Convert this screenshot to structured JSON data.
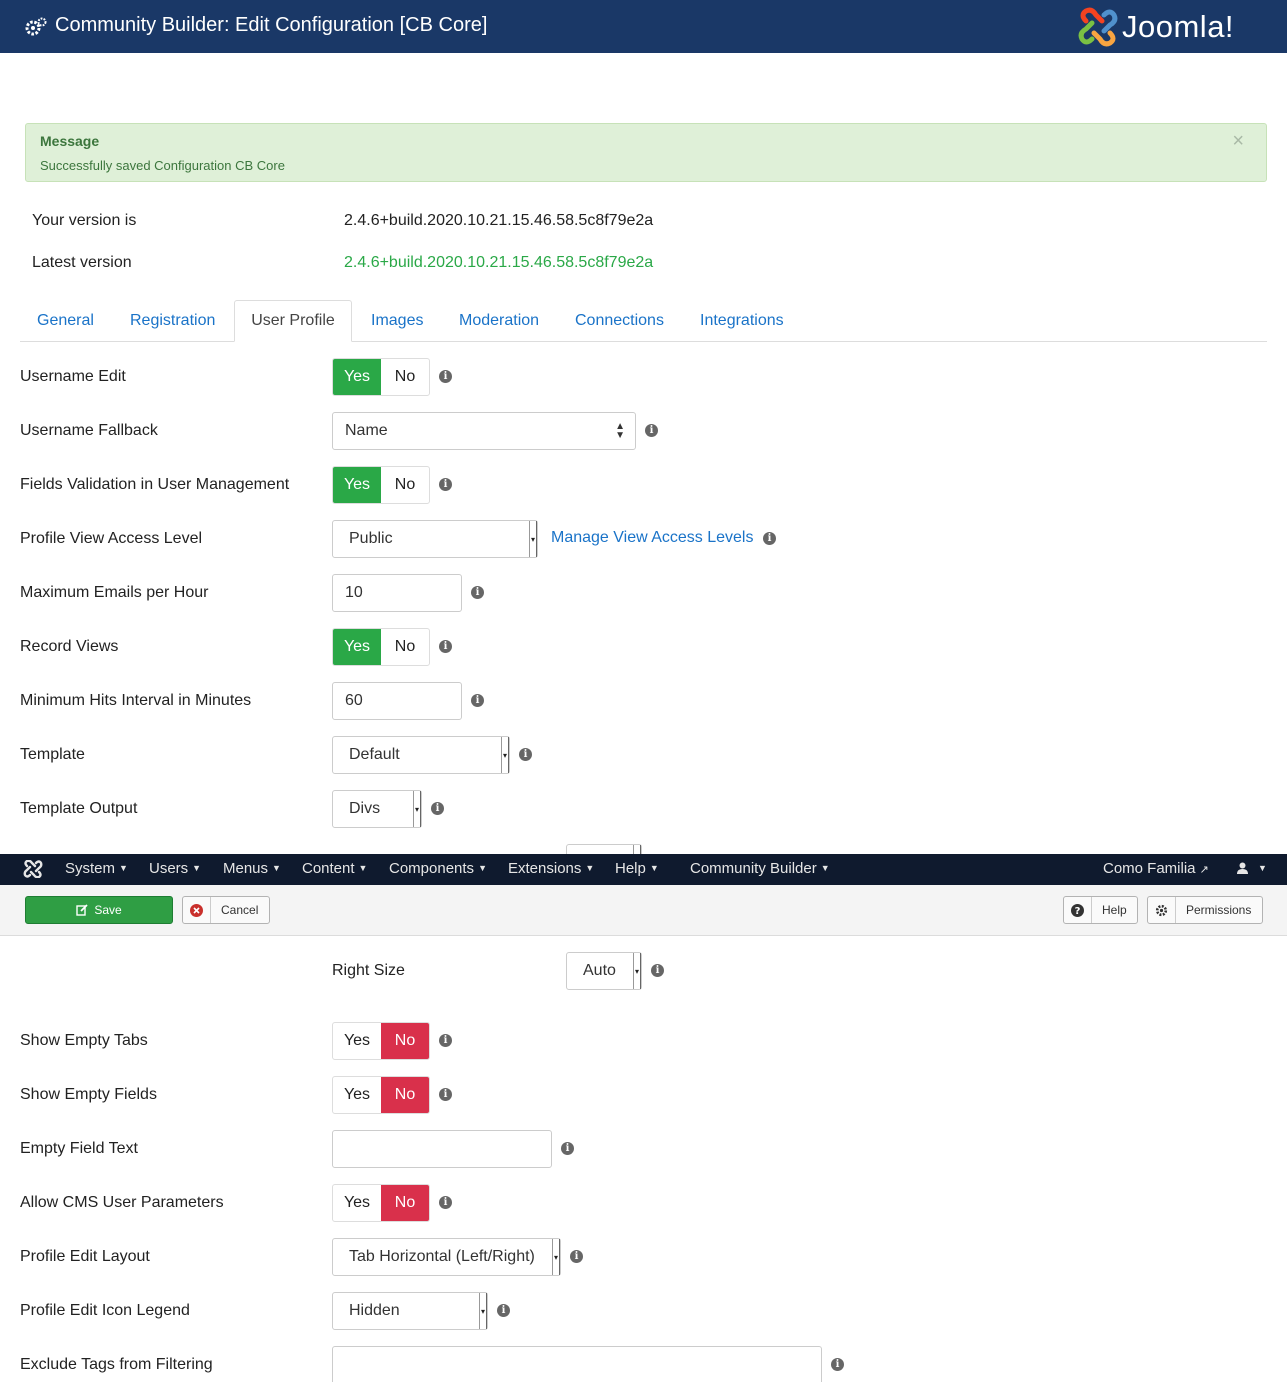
{
  "header": {
    "title": "Community Builder: Edit Configuration [CB Core]",
    "brand": "Joomla!"
  },
  "message": {
    "heading": "Message",
    "text": "Successfully saved Configuration CB Core",
    "close": "×"
  },
  "version": {
    "your_label": "Your version is",
    "your_value": "2.4.6+build.2020.10.21.15.46.58.5c8f79e2a",
    "latest_label": "Latest version",
    "latest_value": "2.4.6+build.2020.10.21.15.46.58.5c8f79e2a"
  },
  "tabs": [
    "General",
    "Registration",
    "User Profile",
    "Images",
    "Moderation",
    "Connections",
    "Integrations"
  ],
  "fields": {
    "username_edit": "Username Edit",
    "username_fallback": "Username Fallback",
    "username_fallback_value": "Name",
    "fields_validation": "Fields Validation in User Management",
    "profile_view_access": "Profile View Access Level",
    "profile_view_access_value": "Public",
    "manage_view_access": "Manage View Access Levels",
    "max_emails": "Maximum Emails per Hour",
    "max_emails_value": "10",
    "record_views": "Record Views",
    "min_hits": "Minimum Hits Interval in Minutes",
    "min_hits_value": "60",
    "template": "Template",
    "template_value": "Default",
    "template_output": "Template Output",
    "template_output_value": "Divs",
    "right_size": "Right Size",
    "right_size_value": "Auto",
    "show_empty_tabs": "Show Empty Tabs",
    "show_empty_fields": "Show Empty Fields",
    "empty_field_text": "Empty Field Text",
    "empty_field_text_value": "",
    "allow_cms_params": "Allow CMS User Parameters",
    "profile_edit_layout": "Profile Edit Layout",
    "profile_edit_layout_value": "Tab Horizontal (Left/Right)",
    "profile_edit_icon": "Profile Edit Icon Legend",
    "profile_edit_icon_value": "Hidden",
    "exclude_tags": "Exclude Tags from Filtering",
    "exclude_tags_value": ""
  },
  "toggle": {
    "yes": "Yes",
    "no": "No"
  },
  "navbar": {
    "items": [
      "System",
      "Users",
      "Menus",
      "Content",
      "Components",
      "Extensions",
      "Help",
      "Community Builder"
    ],
    "site": "Como Familia"
  },
  "toolbar": {
    "save": "Save",
    "cancel": "Cancel",
    "help": "Help",
    "permissions": "Permissions"
  },
  "colors": {
    "header_bg": "#1a3867",
    "success_green": "#2aa847",
    "danger_red": "#d9304b",
    "link_blue": "#1a73c8",
    "navbar_bg": "#0f1a2e"
  }
}
